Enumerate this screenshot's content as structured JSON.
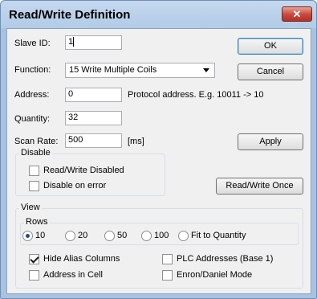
{
  "window": {
    "title": "Read/Write Definition",
    "close_symbol": "✕"
  },
  "fields": {
    "slave_id": {
      "label": "Slave ID:",
      "value": "1"
    },
    "function": {
      "label": "Function:",
      "value": "15 Write Multiple Coils"
    },
    "address": {
      "label": "Address:",
      "value": "0",
      "hint": "Protocol address. E.g. 10011 -> 10"
    },
    "quantity": {
      "label": "Quantity:",
      "value": "32"
    },
    "scan_rate": {
      "label": "Scan Rate:",
      "value": "500",
      "unit": "[ms]"
    }
  },
  "buttons": {
    "ok": "OK",
    "cancel": "Cancel",
    "apply": "Apply",
    "read_write_once": "Read/Write Once"
  },
  "disable_group": {
    "title": "Disable",
    "read_write_disabled": {
      "label": "Read/Write Disabled",
      "checked": false
    },
    "disable_on_error": {
      "label": "Disable on error",
      "checked": false
    }
  },
  "view_group": {
    "title": "View",
    "rows": {
      "title": "Rows",
      "options": [
        "10",
        "20",
        "50",
        "100",
        "Fit to Quantity"
      ],
      "selected": "10"
    },
    "hide_alias_columns": {
      "label": "Hide Alias Columns",
      "checked": true
    },
    "address_in_cell": {
      "label": "Address in Cell",
      "checked": false
    },
    "plc_addresses": {
      "label": "PLC Addresses (Base 1)",
      "checked": false
    },
    "enron_daniel_mode": {
      "label": "Enron/Daniel Mode",
      "checked": false
    }
  }
}
